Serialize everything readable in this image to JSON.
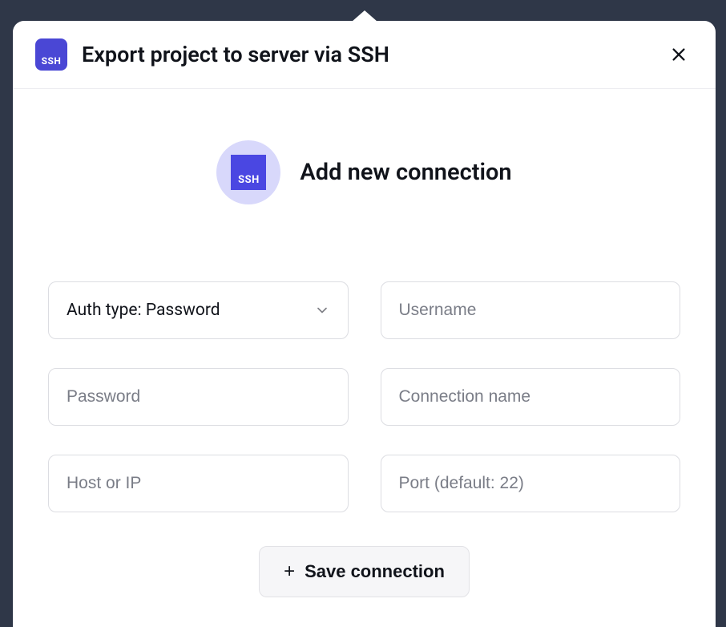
{
  "header": {
    "ssh_badge_text": "SSH",
    "title": "Export project to server via SSH"
  },
  "section": {
    "ssh_badge_text": "SSH",
    "title": "Add new connection"
  },
  "form": {
    "auth_type": {
      "label": "Auth type: Password"
    },
    "username": {
      "placeholder": "Username",
      "value": ""
    },
    "password": {
      "placeholder": "Password",
      "value": ""
    },
    "connection_name": {
      "placeholder": "Connection name",
      "value": ""
    },
    "host": {
      "placeholder": "Host or IP",
      "value": ""
    },
    "port": {
      "placeholder": "Port (default: 22)",
      "value": ""
    }
  },
  "footer": {
    "save_label": "Save connection"
  }
}
